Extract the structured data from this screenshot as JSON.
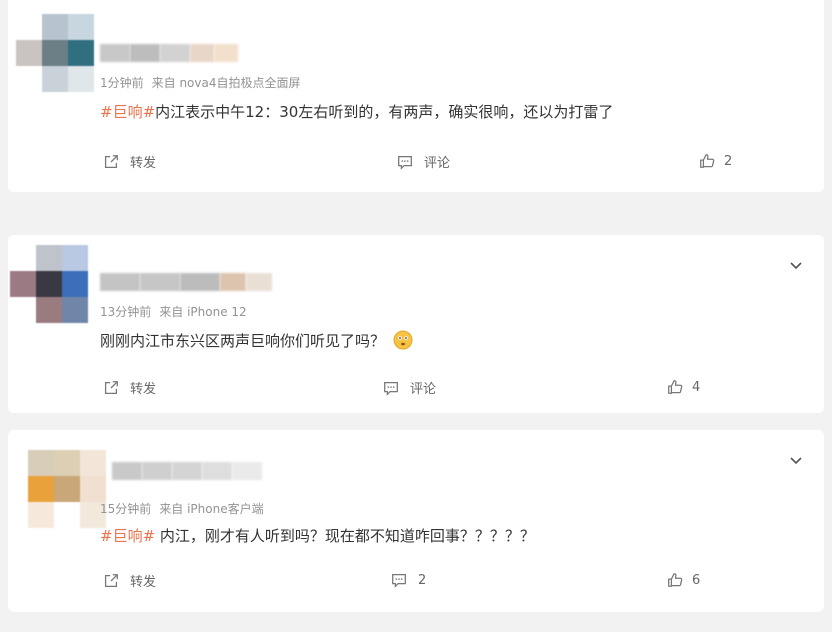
{
  "comments": [
    {
      "time": "1分钟前",
      "source": "来自 nova4自拍极点全面屏",
      "tag": "#巨响#",
      "text": "内江表示中午12：30左右听到的，有两声，确实很响，还以为打雷了",
      "repost_label": "转发",
      "comment_label": "评论",
      "like_count": "2",
      "avatar_colors": [
        "#ffffff",
        "#b7c4cf",
        "#c7d6df",
        "#c9c4c1",
        "#6d7f86",
        "#2f6f80",
        "#ffffff",
        "#c9d2d8",
        "#dfe7ea"
      ],
      "name_colors": [
        "#c8c8c8",
        "#bdbdbd",
        "#d2d2d2",
        "#e8d6c8",
        "#f3e0cc"
      ]
    },
    {
      "time": "13分钟前",
      "source": "来自 iPhone 12",
      "tag": "",
      "text": "刚刚内江市东兴区两声巨响你们听见了吗？",
      "emoji": "thinking-emoji",
      "repost_label": "转发",
      "comment_label": "评论",
      "like_count": "4",
      "avatar_colors": [
        "#ffffff",
        "#bfc3cc",
        "#b9c9e4",
        "#9c7a84",
        "#3a3842",
        "#3b6fb9",
        "#ffffff",
        "#9a7b7f",
        "#6f86a8"
      ],
      "name_colors": [
        "#c4c4c4",
        "#c6c6c6",
        "#bcbcbc",
        "#dcc4ae",
        "#e9dfd5"
      ]
    },
    {
      "time": "15分钟前",
      "source": "来自 iPhone客户端",
      "tag": "#巨响#",
      "text": " 内江，刚才有人听到吗？现在都不知道咋回事？？？？？",
      "repost_label": "转发",
      "comment_label": "",
      "comment_count": "2",
      "like_count": "6",
      "avatar_colors": [
        "#d8cdb9",
        "#dccfb3",
        "#f3e6d8",
        "#e9a23b",
        "#c9a779",
        "#f1dfcf",
        "#f6e9dc",
        "#ffffff",
        "#f2e8dc"
      ],
      "name_colors": [
        "#c9c9c9",
        "#cfcfcf",
        "#d4d4d4",
        "#dedede",
        "#eaeaea"
      ]
    }
  ],
  "colors": {
    "tag": "#eb7350",
    "meta": "#939393",
    "background": "#f2f2f2"
  },
  "icons": {
    "repost": "repost-icon",
    "comment": "comment-icon",
    "like": "thumbs-up-icon",
    "expand": "chevron-down-icon"
  }
}
